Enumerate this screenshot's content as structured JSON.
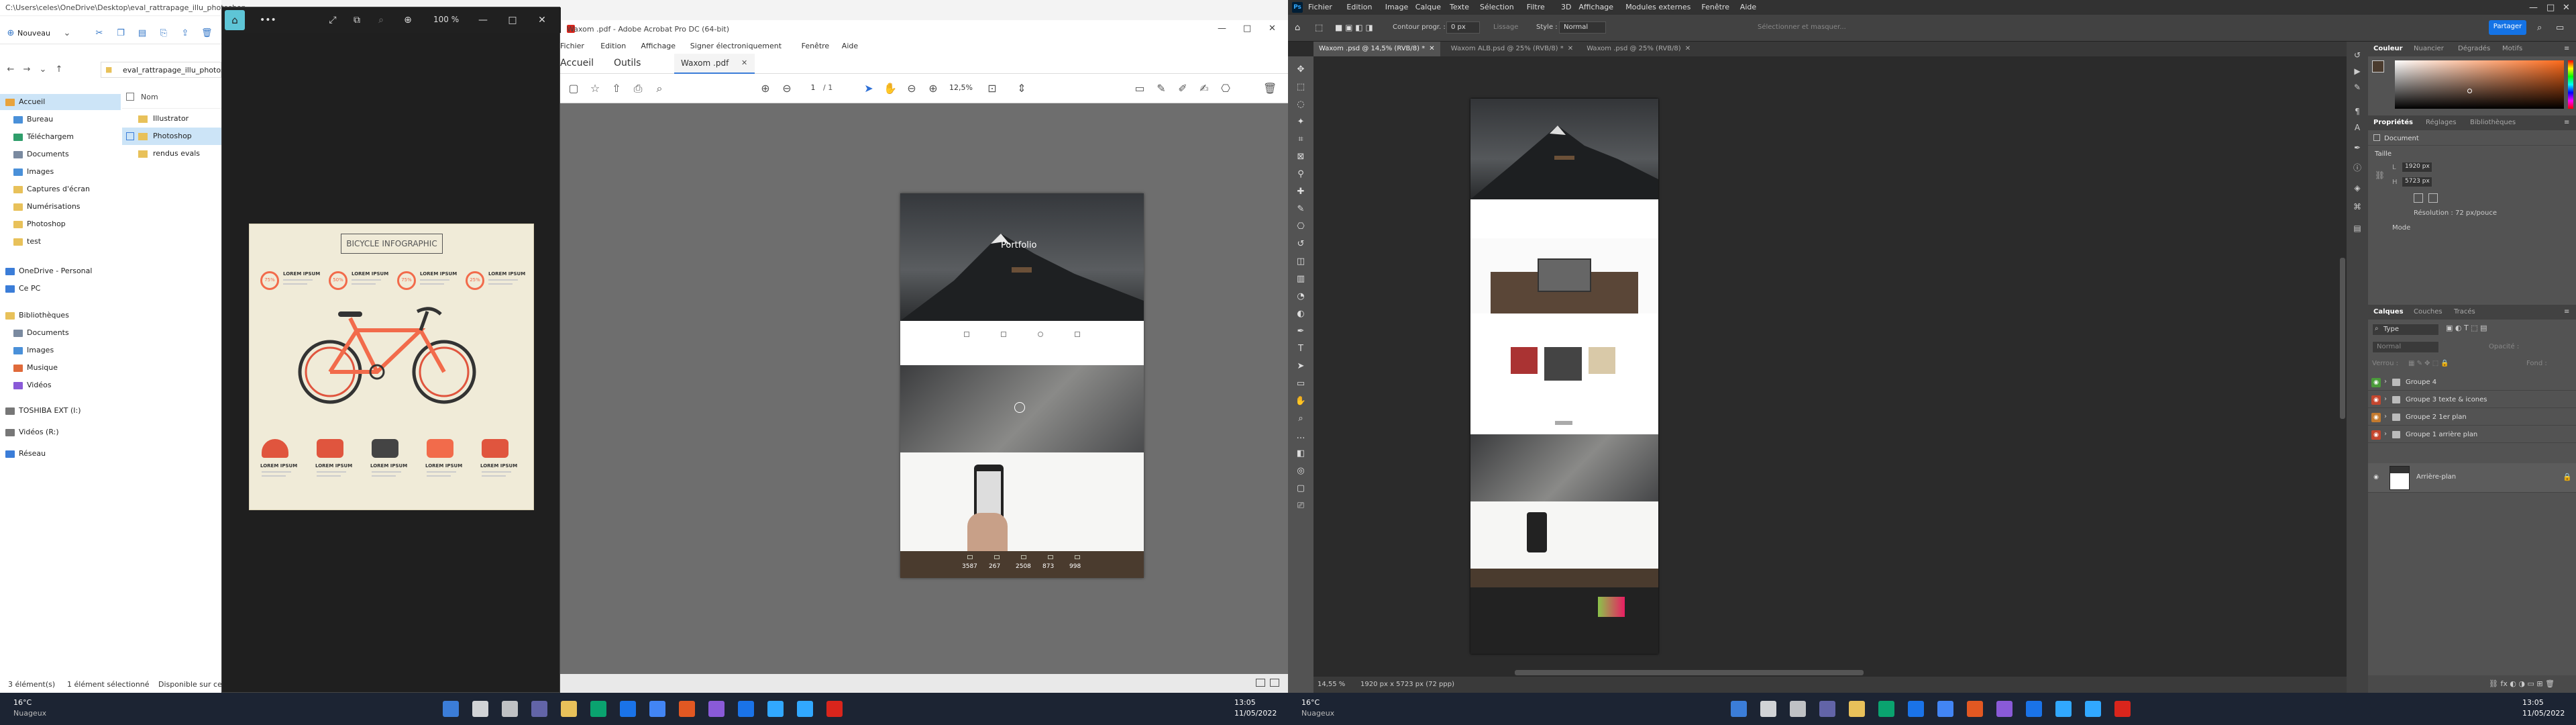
{
  "left_monitor": {
    "explorer": {
      "title_path": "C:\\Users\\celes\\OneDrive\\Desktop\\eval_rattrapage_illu_photoshop",
      "new_button": "Nouveau",
      "address_text": "eval_rattrapage_illu_photosh",
      "nav_tree": [
        {
          "label": "Accueil",
          "selected": true,
          "color": "#e8a33d"
        },
        {
          "label": "Bureau",
          "color": "#4a90d9"
        },
        {
          "label": "Téléchargem",
          "color": "#2f9e6b"
        },
        {
          "label": "Documents",
          "color": "#7a8aa0"
        },
        {
          "label": "Images",
          "color": "#4a90d9"
        },
        {
          "label": "Captures d'écran",
          "color": "#e8c15a"
        },
        {
          "label": "Numérisations",
          "color": "#e8c15a"
        },
        {
          "label": "Photoshop",
          "color": "#e8c15a"
        },
        {
          "label": "test",
          "color": "#e8c15a"
        },
        {
          "label": "OneDrive - Personal",
          "color": "#3b7dd8"
        },
        {
          "label": "Ce PC",
          "color": "#3b7dd8"
        },
        {
          "label": "Bibliothèques",
          "color": "#e8c15a"
        },
        {
          "label": "Documents",
          "color": "#7a8aa0"
        },
        {
          "label": "Images",
          "color": "#4a90d9"
        },
        {
          "label": "Musique",
          "color": "#e06a3a"
        },
        {
          "label": "Vidéos",
          "color": "#8a5ad8"
        },
        {
          "label": "TOSHIBA EXT (I:)",
          "color": "#777777"
        },
        {
          "label": "Vidéos (R:)",
          "color": "#777777"
        },
        {
          "label": "Réseau",
          "color": "#3b7dd8"
        }
      ],
      "column_name": "Nom",
      "files": [
        {
          "label": "Illustrator",
          "selected": false
        },
        {
          "label": "Photoshop",
          "selected": true
        },
        {
          "label": "rendus evals",
          "selected": false
        }
      ],
      "status": {
        "count": "3 élément(s)",
        "selected": "1 élément sélectionné",
        "avail": "Disponible sur cet"
      }
    },
    "viewer": {
      "zoom": "100 %",
      "infographic_title": "BICYCLE INFOGRAPHIC",
      "infographic_labels": [
        "LOREM IPSUM",
        "LOREM IPSUM",
        "LOREM IPSUM",
        "LOREM IPSUM"
      ],
      "percent_labels": [
        "75%",
        "50%",
        "75%",
        "25%"
      ],
      "bottom_labels": [
        "LOREM IPSUM",
        "LOREM IPSUM",
        "LOREM IPSUM",
        "LOREM IPSUM",
        "LOREM IPSUM"
      ]
    },
    "acrobat": {
      "title": "Waxom .pdf - Adobe Acrobat Pro DC (64-bit)",
      "menu": [
        "Fichier",
        "Edition",
        "Affichage",
        "Signer électroniquement",
        "Fenêtre",
        "Aide"
      ],
      "tabs": [
        "Accueil",
        "Outils",
        "Waxom .pdf"
      ],
      "page_of": "/ 1",
      "page_num": "1",
      "zoom": "12,5%",
      "page_hero_title": "Portfolio",
      "page_stats": [
        "3587",
        "267",
        "2508",
        "873",
        "998"
      ]
    },
    "taskbar": {
      "temp": "16°C",
      "weather": "Nuageux",
      "time": "13:05",
      "date": "11/05/2022"
    }
  },
  "right_monitor": {
    "photoshop": {
      "menu": [
        "Fichier",
        "Edition",
        "Image",
        "Calque",
        "Texte",
        "Sélection",
        "Filtre",
        "3D",
        "Affichage",
        "Modules externes",
        "Fenêtre",
        "Aide"
      ],
      "options": {
        "contour_label": "Contour progr. :",
        "contour_value": "0 px",
        "lissage": "Lissage",
        "style_label": "Style :",
        "style_value": "Normal",
        "select_mask": "Sélectionner et masquer...",
        "share": "Partager"
      },
      "doc_tabs": [
        {
          "label": "Waxom .psd @ 14,5% (RVB/8) *",
          "active": true
        },
        {
          "label": "Waxom ALB.psd @ 25% (RVB/8) *",
          "active": false
        },
        {
          "label": "Waxom .psd @ 25% (RVB/8)",
          "active": false
        }
      ],
      "status_zoom": "14,55 %",
      "status_size": "1920 px x 5723 px (72 ppp)",
      "color_panel_tabs": [
        "Couleur",
        "Nuancier",
        "Dégradés",
        "Motifs"
      ],
      "props_tabs": [
        "Propriétés",
        "Réglages",
        "Bibliothèques"
      ],
      "props_doc": "Document",
      "props_section": "Taille",
      "width": "1920 px",
      "height": "5723 px",
      "resolution": "Résolution : 72 px/pouce",
      "mode": "Mode",
      "layers_tabs": [
        "Calques",
        "Couches",
        "Tracés"
      ],
      "layers_filter": "Type",
      "blend": "Normal",
      "opacity_label": "Opacité :",
      "fill_label": "Fond :",
      "lock_label": "Verrou :",
      "layers": [
        {
          "name": "Groupe 4",
          "eye_color": "#4a9b3a"
        },
        {
          "name": "Groupe 3 texte & icones",
          "eye_color": "#c4462e"
        },
        {
          "name": "Groupe 2 1er plan",
          "eye_color": "#c47a2e"
        },
        {
          "name": "Groupe 1 arrière plan",
          "eye_color": "#c4462e"
        }
      ],
      "bg_layer": "Arrière-plan",
      "accent": "#ff8c1a"
    },
    "taskbar": {
      "temp": "16°C",
      "weather": "Nuageux",
      "time": "13:05",
      "date": "11/05/2022"
    }
  }
}
